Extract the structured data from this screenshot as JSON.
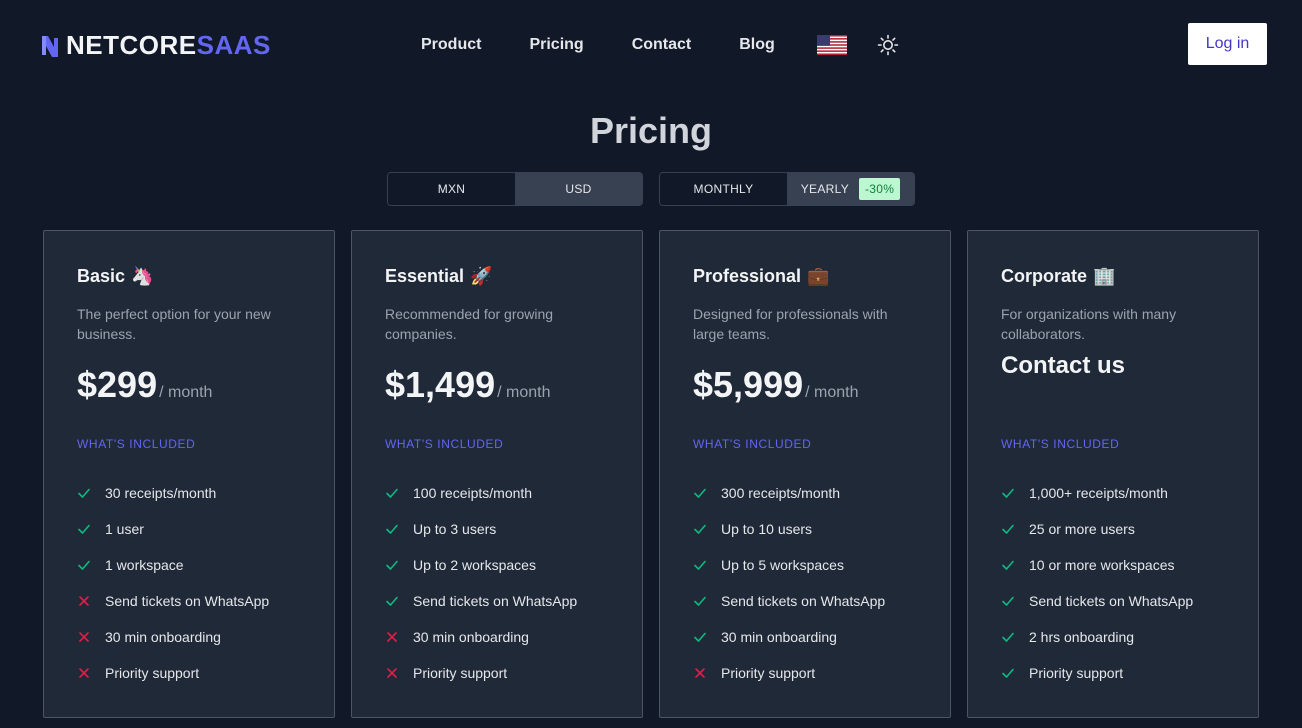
{
  "header": {
    "logo_primary": "NETCORE",
    "logo_accent": "SAAS",
    "nav": [
      "Product",
      "Pricing",
      "Contact",
      "Blog"
    ],
    "login_label": "Log in"
  },
  "page": {
    "title": "Pricing"
  },
  "toggles": {
    "currency": {
      "options": [
        "MXN",
        "USD"
      ],
      "selected": "USD"
    },
    "period": {
      "options": [
        "MONTHLY",
        "YEARLY"
      ],
      "selected": "YEARLY",
      "discount": "-30%"
    }
  },
  "included_label": "WHAT'S INCLUDED",
  "plans": [
    {
      "name": "Basic",
      "emoji": "🦄",
      "desc": "The perfect option for your new business.",
      "price": "$299",
      "per": "/ month",
      "features": [
        {
          "label": "30 receipts/month",
          "included": true
        },
        {
          "label": "1 user",
          "included": true
        },
        {
          "label": "1 workspace",
          "included": true
        },
        {
          "label": "Send tickets on WhatsApp",
          "included": false
        },
        {
          "label": "30 min onboarding",
          "included": false
        },
        {
          "label": "Priority support",
          "included": false
        }
      ]
    },
    {
      "name": "Essential",
      "emoji": "🚀",
      "desc": "Recommended for growing companies.",
      "price": "$1,499",
      "per": "/ month",
      "features": [
        {
          "label": "100 receipts/month",
          "included": true
        },
        {
          "label": "Up to 3 users",
          "included": true
        },
        {
          "label": "Up to 2 workspaces",
          "included": true
        },
        {
          "label": "Send tickets on WhatsApp",
          "included": true
        },
        {
          "label": "30 min onboarding",
          "included": false
        },
        {
          "label": "Priority support",
          "included": false
        }
      ]
    },
    {
      "name": "Professional",
      "emoji": "💼",
      "desc": "Designed for professionals with large teams.",
      "price": "$5,999",
      "per": "/ month",
      "features": [
        {
          "label": "300 receipts/month",
          "included": true
        },
        {
          "label": "Up to 10 users",
          "included": true
        },
        {
          "label": "Up to 5 workspaces",
          "included": true
        },
        {
          "label": "Send tickets on WhatsApp",
          "included": true
        },
        {
          "label": "30 min onboarding",
          "included": true
        },
        {
          "label": "Priority support",
          "included": false
        }
      ]
    },
    {
      "name": "Corporate",
      "emoji": "🏢",
      "desc": "For organizations with many collaborators.",
      "contact": "Contact us",
      "features": [
        {
          "label": "1,000+ receipts/month",
          "included": true
        },
        {
          "label": "25 or more users",
          "included": true
        },
        {
          "label": "10 or more workspaces",
          "included": true
        },
        {
          "label": "Send tickets on WhatsApp",
          "included": true
        },
        {
          "label": "2 hrs onboarding",
          "included": true
        },
        {
          "label": "Priority support",
          "included": true
        }
      ]
    }
  ],
  "colors": {
    "background": "#111827",
    "card": "#1f2937",
    "accent": "#6366f1",
    "check": "#10b981",
    "cross": "#e11d48"
  }
}
